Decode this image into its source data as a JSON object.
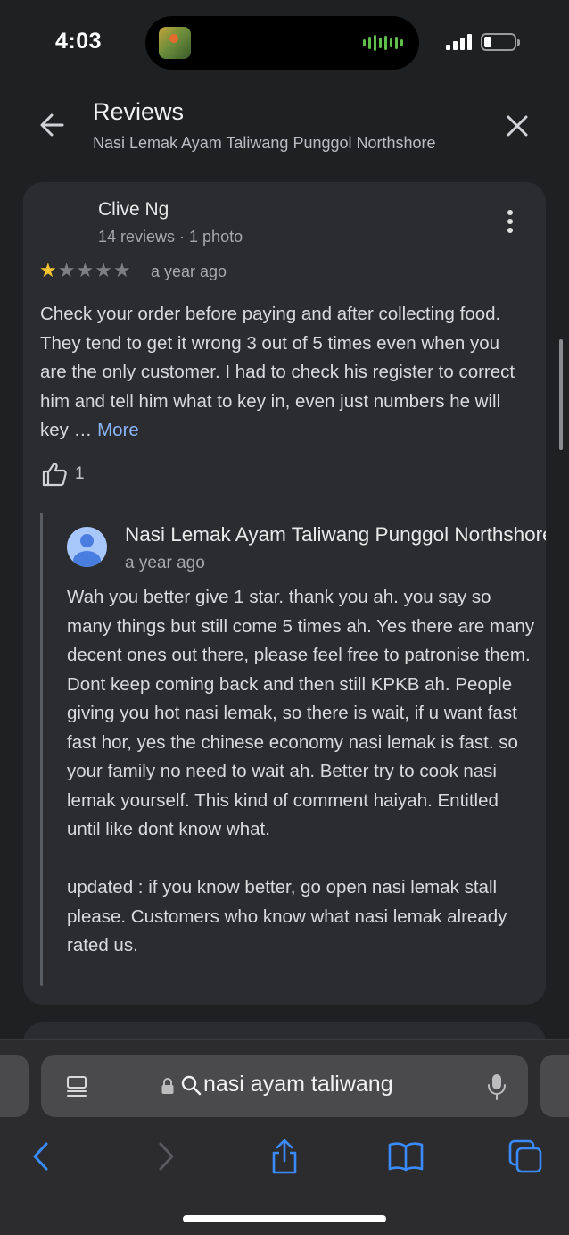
{
  "status_bar": {
    "time": "4:03"
  },
  "header": {
    "title": "Reviews",
    "subtitle": "Nasi Lemak Ayam Taliwang Punggol Northshore"
  },
  "review": {
    "reviewer_name": "Clive Ng",
    "reviewer_meta": "14 reviews · 1 photo",
    "rating": 1,
    "rating_max": 5,
    "date": "a year ago",
    "text": "Check your order before paying and after collecting food. They tend to get it wrong 3 out of 5 times even when you are the only customer. I had to check his register to correct him and tell him what to key in, even just numbers he will key …",
    "more_label": "More",
    "like_count": "1"
  },
  "owner_reply": {
    "name": "Nasi Lemak Ayam Taliwang Punggol Northshore",
    "date": "a year ago",
    "paragraph1": "Wah you better give 1 star. thank you ah. you say so many things but still come 5 times ah. Yes there are many decent ones out there, please feel free to patronise them. Dont keep coming back and then still KPKB ah. People giving you hot nasi lemak, so there is wait, if u want fast fast hor, yes the chinese economy nasi lemak is fast. so your family no need to wait ah. Better try to cook nasi lemak yourself. This kind of comment haiyah. Entitled until like dont know what.",
    "paragraph2": "updated : if you know better, go open nasi lemak stall please. Customers who know what nasi lemak already rated us."
  },
  "safari": {
    "url_text": "nasi ayam taliwang"
  },
  "colors": {
    "background": "#1f2022",
    "card": "#2b2c2f",
    "accent_link": "#8ab4f8",
    "star_filled": "#f5c531",
    "toolbar_blue": "#3a8bff"
  }
}
